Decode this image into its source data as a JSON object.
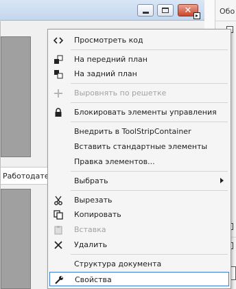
{
  "right_panel": {
    "tab_label": "Обо"
  },
  "form": {
    "employer_label": "Работодатель"
  },
  "context_menu": {
    "items": [
      {
        "label": "Просмотреть код",
        "icon": "view-code-icon",
        "enabled": true
      },
      {
        "label": "На передний план",
        "icon": "bring-to-front-icon",
        "enabled": true
      },
      {
        "label": "На задний план",
        "icon": "send-to-back-icon",
        "enabled": true
      },
      {
        "label": "Выровнять по решетке",
        "icon": "align-to-grid-icon",
        "enabled": false
      },
      {
        "label": "Блокировать элементы управления",
        "icon": "lock-icon",
        "enabled": true
      },
      {
        "label": "Внедрить в ToolStripContainer",
        "icon": "",
        "enabled": true
      },
      {
        "label": "Вставить стандартные элементы",
        "icon": "",
        "enabled": true
      },
      {
        "label": "Правка элементов...",
        "icon": "",
        "enabled": true
      },
      {
        "label": "Выбрать",
        "icon": "",
        "enabled": true,
        "has_submenu": true
      },
      {
        "label": "Вырезать",
        "icon": "scissors-icon",
        "enabled": true
      },
      {
        "label": "Копировать",
        "icon": "copy-icon",
        "enabled": true
      },
      {
        "label": "Вставка",
        "icon": "paste-icon",
        "enabled": false
      },
      {
        "label": "Удалить",
        "icon": "delete-icon",
        "enabled": true
      },
      {
        "label": "Структура документа",
        "icon": "",
        "enabled": true
      },
      {
        "label": "Свойства",
        "icon": "wrench-icon",
        "enabled": true,
        "highlighted": true
      }
    ]
  },
  "colors": {
    "menu_background": "#f5f5f5",
    "highlight_border": "#3a7bd5",
    "disabled_text": "#a2a2a2",
    "close_button": "#c9462c"
  }
}
